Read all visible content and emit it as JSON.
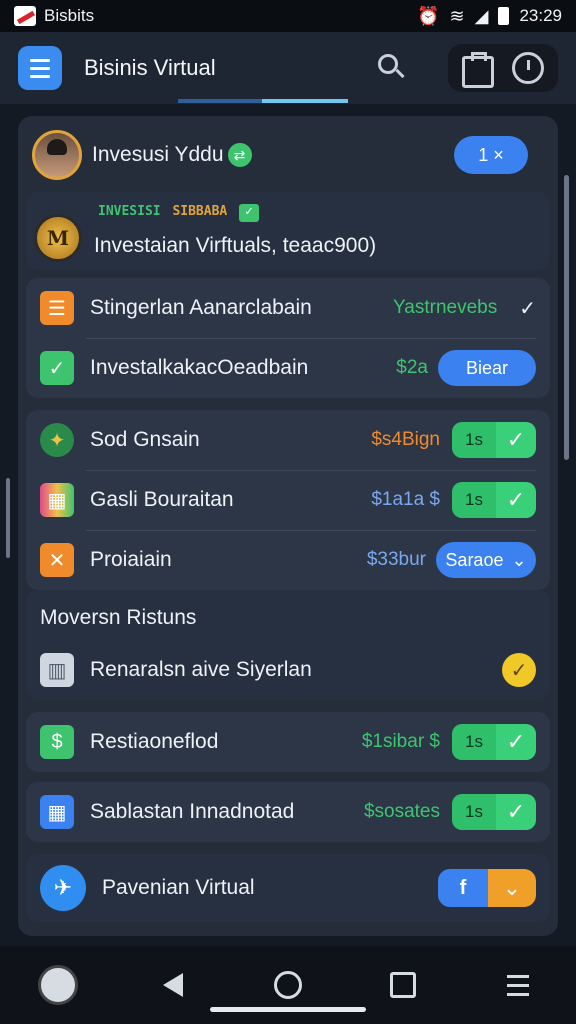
{
  "status_bar": {
    "carrier": "Bisbits",
    "time": "23:29",
    "alarm_icon": "alarm-icon",
    "wifi_icon": "wifi-icon",
    "signal_icon": "signal-icon",
    "battery_icon": "battery-icon"
  },
  "app_bar": {
    "title": "Bisinis Virtual",
    "menu_icon": "menu-icon",
    "search_icon": "search-icon",
    "clipboard_icon": "clipboard-icon",
    "timer_icon": "timer-icon"
  },
  "profile": {
    "name": "Invesusi Yddu",
    "badge_text": "1 ×"
  },
  "investment": {
    "tag": "INVESISI",
    "tag_accent": "SIBBABA",
    "title": "Investaian Virftuals, teaac900)"
  },
  "list_a": [
    {
      "label": "Stingerlan Aanarclabain",
      "value": "Yastrnevebs",
      "value_color": "#3ec46f",
      "icon": "list-icon"
    },
    {
      "label": "InvestalkakacOeadbain",
      "value": "$2a",
      "value_color": "#3ec46f",
      "button": "Biear",
      "icon": "check-icon"
    }
  ],
  "list_b": [
    {
      "label": "Sod Gnsain",
      "value": "$s4Bign",
      "value_color": "#f08a2a",
      "num": "1s",
      "icon": "compass-icon"
    },
    {
      "label": "Gasli Bouraitan",
      "value": "$1a1a   $",
      "value_color": "#7aa8f0",
      "num": "1s",
      "icon": "blocks-icon"
    },
    {
      "label": "Proiaiain",
      "value": "$33bur",
      "value_color": "#7aa8f0",
      "dropdown": "Saraoe",
      "icon": "flag-icon"
    }
  ],
  "movers": {
    "title": "Moversn Ristuns",
    "item_label": "Renaralsn aive Siyerlan",
    "icon": "box-icon"
  },
  "list_c": [
    {
      "label": "Restiaoneflod",
      "value": "$1sibar   $",
      "value_color": "#3ec46f",
      "num": "1s",
      "icon": "cash-icon"
    },
    {
      "label": "Sablastan Innadnotad",
      "value": "$sosates",
      "value_color": "#3ec46f",
      "num": "1s",
      "icon": "calendar-icon"
    }
  ],
  "footer_card": {
    "label": "Pavenian Virtual",
    "button": "f",
    "icon": "plane-icon"
  },
  "nav": {
    "back_icon": "back-icon",
    "home_icon": "home-icon",
    "recents_icon": "recents-icon",
    "menu_icon": "menu-lines-icon",
    "clock_icon": "clock-icon"
  },
  "colors": {
    "accent": "#3b82f0",
    "green": "#3ec46f",
    "orange": "#f08a2a",
    "background": "#141a24",
    "card": "#2d3646"
  }
}
